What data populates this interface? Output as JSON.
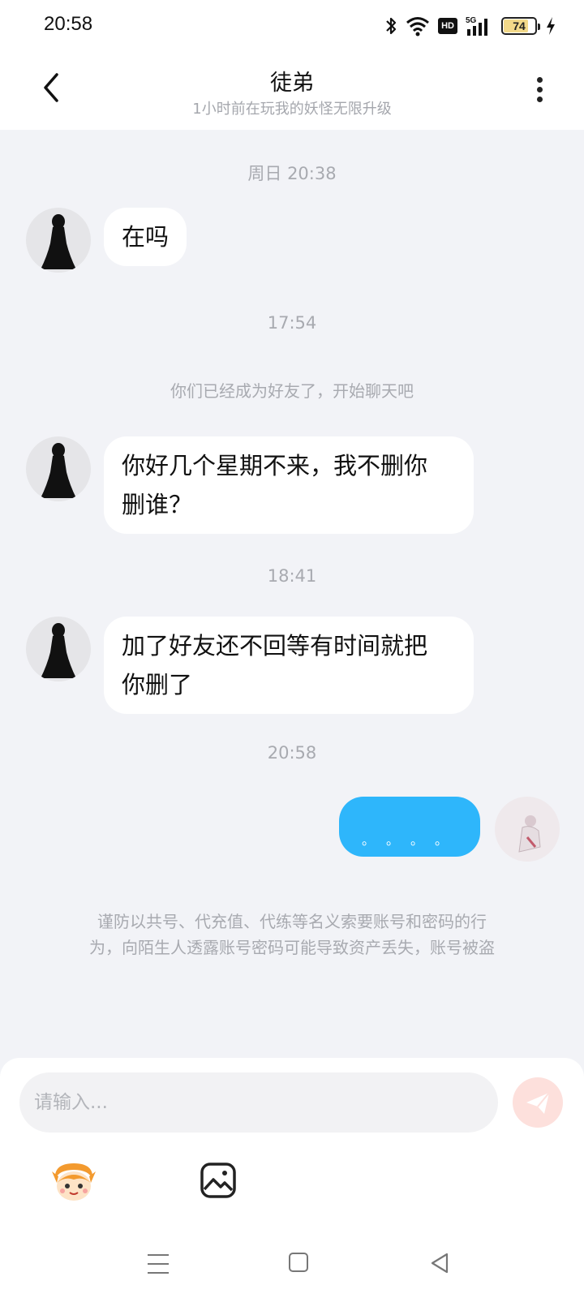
{
  "status_bar": {
    "time": "20:58",
    "network_label": "5G",
    "hd_label": "HD",
    "battery_level": "74"
  },
  "header": {
    "title": "徒弟",
    "subtitle": "1小时前在玩我的妖怪无限升级"
  },
  "chat": {
    "timestamps": [
      "周日 20:38",
      "17:54",
      "18:41",
      "20:58"
    ],
    "system_message": "你们已经成为好友了，开始聊天吧",
    "messages": [
      {
        "direction": "in",
        "text": "在吗"
      },
      {
        "direction": "in",
        "line1": "你好几个星期不来，我不删你",
        "line2": "删谁？"
      },
      {
        "direction": "in",
        "line1": "加了好友还不回等有时间就把",
        "line2": "你删了"
      },
      {
        "direction": "out",
        "text": "。。。。"
      }
    ],
    "warning_line1": "谨防以共号、代充值、代练等名义索要账号和密码的行",
    "warning_line2": "为，向陌生人透露账号密码可能导致资产丢失，账号被盗"
  },
  "input": {
    "placeholder": "请输入..."
  },
  "colors": {
    "outgoing_bubble": "#2eb6fb",
    "incoming_bubble": "#ffffff",
    "background": "#f2f3f7",
    "send_button": "#fde0dc"
  },
  "icons": {
    "back": "chevron-left-icon",
    "more": "more-vertical-icon",
    "send": "send-icon",
    "emoji": "emoji-mascot-icon",
    "image": "image-icon"
  }
}
